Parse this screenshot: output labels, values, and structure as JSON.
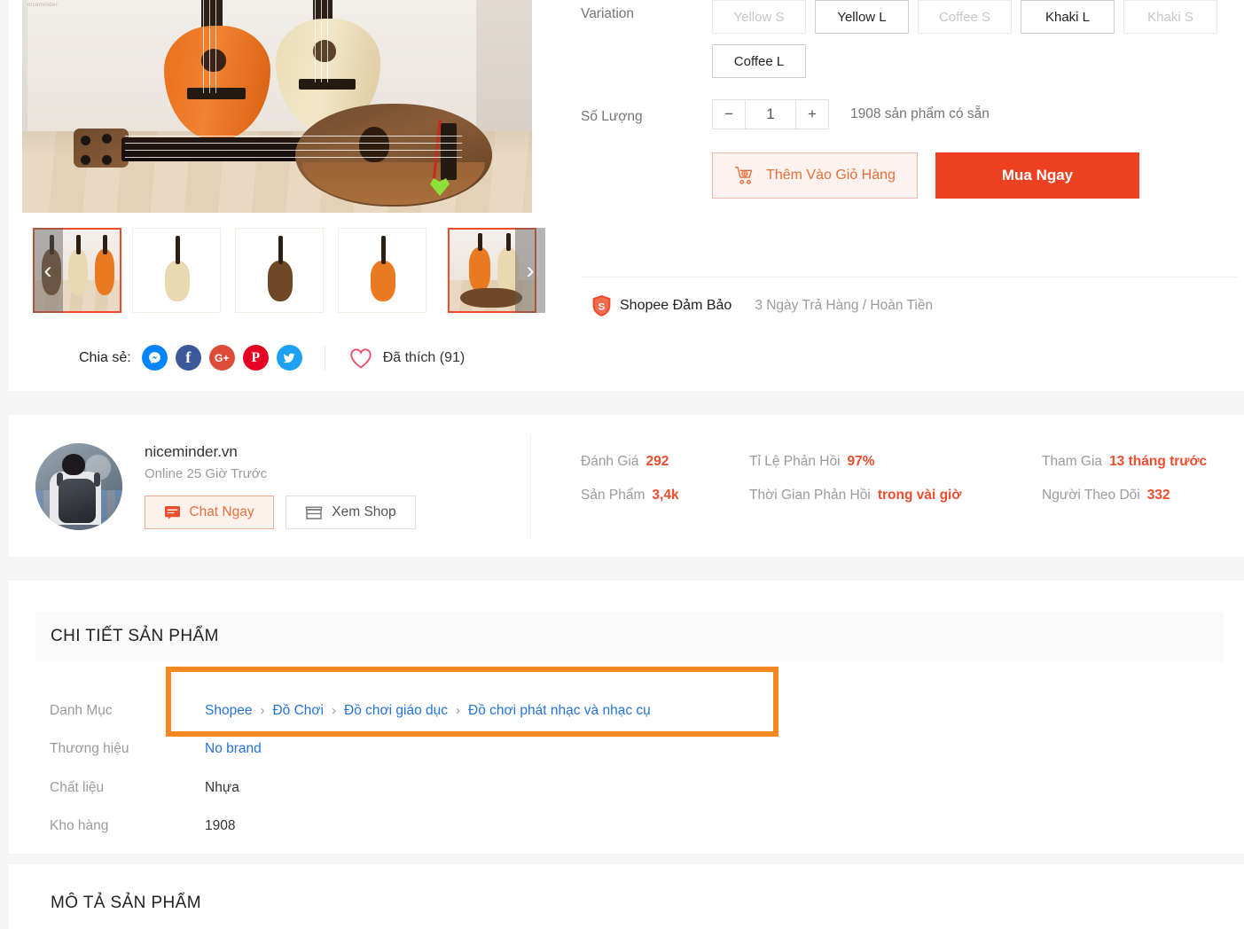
{
  "gallery": {
    "prev_arrow": "‹",
    "next_arrow": "›",
    "watermark": "niceminder",
    "thumbnails": [
      {
        "name": "thumb-1",
        "selected": false
      },
      {
        "name": "thumb-2",
        "selected": false
      },
      {
        "name": "thumb-3",
        "selected": false
      },
      {
        "name": "thumb-4",
        "selected": false
      },
      {
        "name": "thumb-5",
        "selected": true
      }
    ]
  },
  "share": {
    "label": "Chia sẻ:",
    "networks": [
      {
        "name": "messenger",
        "glyph": "~",
        "color": "#0084FF"
      },
      {
        "name": "facebook",
        "glyph": "f",
        "color": "#3B5998"
      },
      {
        "name": "google-plus",
        "glyph": "G+",
        "color": "#DD4B39"
      },
      {
        "name": "pinterest",
        "glyph": "P",
        "color": "#E60023"
      },
      {
        "name": "twitter",
        "glyph": "t",
        "color": "#1DA1F2"
      }
    ],
    "like_text": "Đã thích (91)"
  },
  "variation": {
    "label": "Variation",
    "options": [
      {
        "label": "Yellow S",
        "disabled": true,
        "selected": false
      },
      {
        "label": "Yellow L",
        "disabled": false,
        "selected": false
      },
      {
        "label": "Coffee S",
        "disabled": true,
        "selected": false
      },
      {
        "label": "Khaki L",
        "disabled": false,
        "selected": false
      },
      {
        "label": "Khaki S",
        "disabled": true,
        "selected": false
      },
      {
        "label": "Coffee L",
        "disabled": false,
        "selected": false
      }
    ]
  },
  "quantity": {
    "label": "Số Lượng",
    "minus": "−",
    "value": "1",
    "plus": "+",
    "stock_text": "1908 sản phẩm có sẵn"
  },
  "cta": {
    "add_to_cart": "Thêm Vào Giỏ Hàng",
    "buy_now": "Mua Ngay"
  },
  "guarantee": {
    "title": "Shopee Đảm Bảo",
    "subtitle": "3 Ngày Trả Hàng / Hoàn Tiền",
    "shield_letter": "S"
  },
  "shop": {
    "name": "niceminder.vn",
    "online": "Online 25 Giờ Trước",
    "chat_button": "Chat Ngay",
    "view_button": "Xem Shop",
    "stats": [
      {
        "key": "Đánh Giá",
        "value": "292"
      },
      {
        "key": "Tỉ Lệ Phản Hồi",
        "value": "97%"
      },
      {
        "key": "Tham Gia",
        "value": "13 tháng trước"
      },
      {
        "key": "Sản Phẩm",
        "value": "3,4k"
      },
      {
        "key": "Thời Gian Phản Hồi",
        "value": "trong vài giờ"
      },
      {
        "key": "Người Theo Dõi",
        "value": "332"
      }
    ]
  },
  "detail": {
    "heading": "CHI TIẾT SẢN PHẨM",
    "category_label": "Danh Mục",
    "breadcrumb": [
      "Shopee",
      "Đồ Chơi",
      "Đồ chơi giáo dục",
      "Đồ chơi phát nhạc và nhạc cụ"
    ],
    "breadcrumb_separator": "›",
    "rows": [
      {
        "key": "Thương hiệu",
        "value": "No brand",
        "link": true
      },
      {
        "key": "Chất liệu",
        "value": "Nhựa",
        "link": false
      },
      {
        "key": "Kho hàng",
        "value": "1908",
        "link": false
      }
    ]
  },
  "description": {
    "heading": "MÔ TẢ SẢN PHẨM"
  },
  "colors": {
    "brand_orange": "#ee4d2d",
    "buy_red": "#ee4122",
    "highlight_orange": "#f5881f",
    "link_blue": "#2673dd"
  }
}
